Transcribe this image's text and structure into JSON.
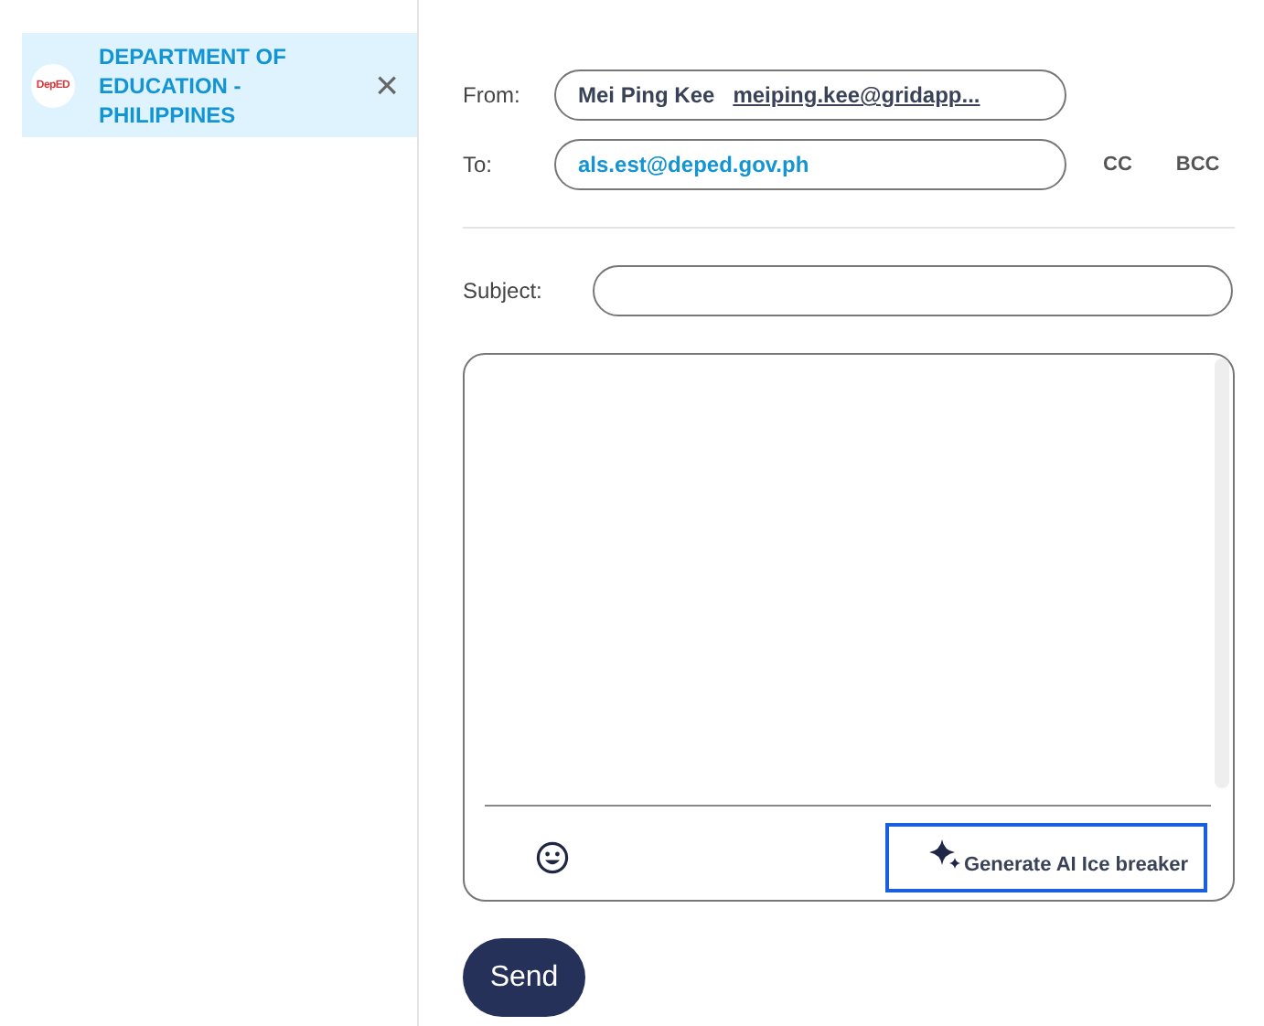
{
  "sidebar": {
    "items": [
      {
        "logo_text": "DepED",
        "label": "DEPARTMENT OF EDUCATION - PHILIPPINES",
        "selected": true,
        "close": "×"
      }
    ]
  },
  "compose": {
    "from": {
      "label": "From:",
      "name": "Mei Ping Kee",
      "email": "meiping.kee@gridapp..."
    },
    "to": {
      "label": "To:",
      "value": "als.est@deped.gov.ph"
    },
    "cc": "CC",
    "bcc": "BCC",
    "subject": {
      "label": "Subject:"
    },
    "ai_button": "Generate AI Ice breaker",
    "send": "Send"
  }
}
